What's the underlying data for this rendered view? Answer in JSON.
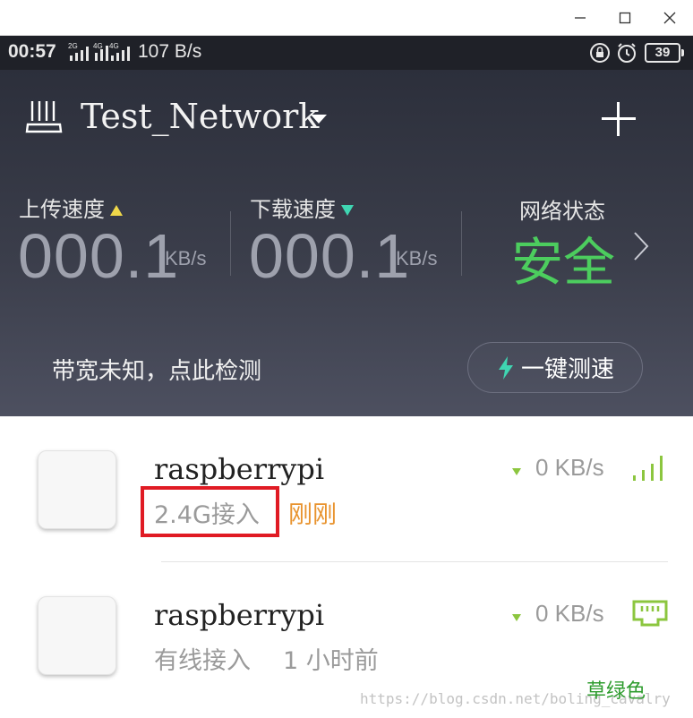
{
  "window": {
    "minimize": "minimize",
    "maximize": "maximize",
    "close": "close"
  },
  "statusbar": {
    "time": "00:57",
    "network_badges": [
      "2G",
      "4G",
      "4G"
    ],
    "speed": "107 B/s",
    "battery": "39"
  },
  "header": {
    "network_name": "Test_Network"
  },
  "stats": {
    "upload_label": "上传速度",
    "upload_value": "000.1",
    "upload_unit": "KB/s",
    "download_label": "下载速度",
    "download_value": "000.1",
    "download_unit": "KB/s",
    "status_label": "网络状态",
    "status_value": "安全"
  },
  "bandwidth": {
    "text": "带宽未知，点此检测",
    "button_label": "一键测速"
  },
  "devices": [
    {
      "name": "raspberrypi",
      "connection": "2.4G接入",
      "time": "刚刚",
      "speed": "0 KB/s",
      "icon": "wifi-signal-icon"
    },
    {
      "name": "raspberrypi",
      "connection": "有线接入",
      "time": "1 小时前",
      "speed": "0 KB/s",
      "icon": "ethernet-icon"
    }
  ],
  "watermark": {
    "url": "https://blog.csdn.net/boling_cavalry",
    "overlay": "草绿色"
  },
  "colors": {
    "accent_green": "#4ccd5e",
    "upload_arrow": "#f0d84a",
    "download_arrow": "#3fd6b2",
    "time_orange": "#e8932e",
    "highlight_red": "#e01b24"
  }
}
